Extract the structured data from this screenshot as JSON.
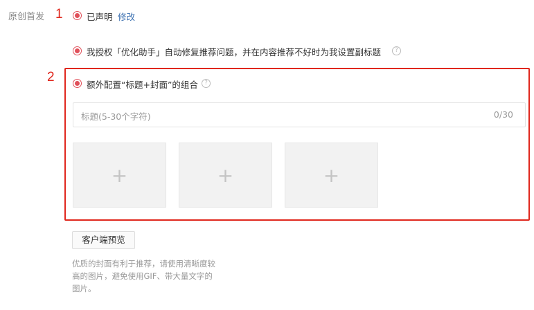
{
  "section": {
    "label": "原创首发"
  },
  "annotations": {
    "one": "1",
    "two": "2"
  },
  "declared": {
    "label": "已声明",
    "edit_link": "修改"
  },
  "authorize": {
    "text": "我授权「优化助手」自动修复推荐问题，并在内容推荐不好时为我设置副标题",
    "help_icon": "question-circle"
  },
  "extra_config": {
    "label": "额外配置“标题+封面”的组合",
    "help_icon": "question-circle",
    "title_input": {
      "placeholder": "标题(5-30个字符)",
      "counter": "0/30"
    },
    "cover_slots": [
      {
        "symbol": "+"
      },
      {
        "symbol": "+"
      },
      {
        "symbol": "+"
      }
    ]
  },
  "preview_button": {
    "label": "客户端预览"
  },
  "hint": {
    "line1": "优质的封面有利于推荐，请使用清晰度较",
    "line2": "高的图片，避免使用GIF、带大量文字的",
    "line3": "图片。"
  },
  "colors": {
    "accent_red": "#e0505a",
    "annotation_red": "#e0271d",
    "link_blue": "#3a6fb0"
  }
}
